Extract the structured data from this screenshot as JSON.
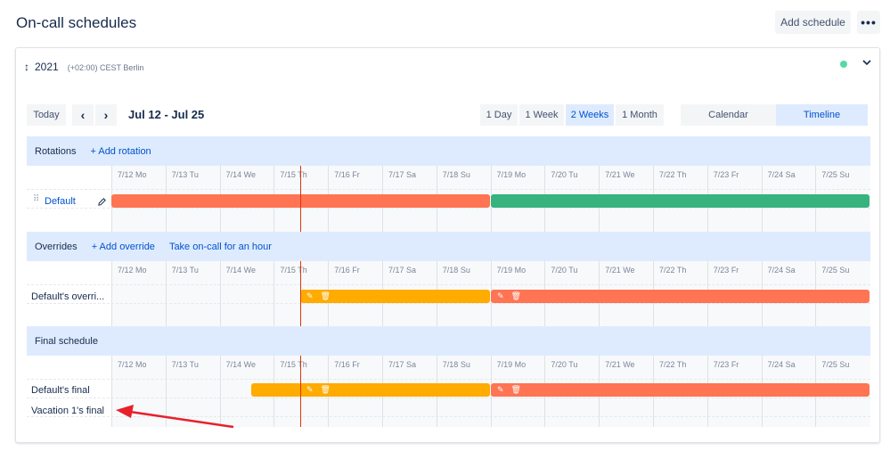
{
  "header": {
    "title": "On-call schedules",
    "add_schedule": "Add schedule",
    "more": "•••"
  },
  "schedule": {
    "year": "2021",
    "sort_icon": "↕",
    "timezone": "(+02:00) CEST Berlin",
    "status_color": "#57d9a3"
  },
  "toolbar": {
    "today": "Today",
    "prev": "‹",
    "next": "›",
    "range": "Jul 12 - Jul 25",
    "views": [
      "1 Day",
      "1 Week",
      "2 Weeks",
      "1 Month"
    ],
    "active_view": "2 Weeks",
    "modes": [
      "Calendar",
      "Timeline"
    ],
    "active_mode": "Timeline"
  },
  "days": [
    "7/12 Mo",
    "7/13 Tu",
    "7/14 We",
    "7/15 Th",
    "7/16 Fr",
    "7/17 Sa",
    "7/18 Su",
    "7/19 Mo",
    "7/20 Tu",
    "7/21 We",
    "7/22 Th",
    "7/23 Fr",
    "7/24 Sa",
    "7/25 Su"
  ],
  "rotations": {
    "title": "Rotations",
    "add_link": "+ Add rotation",
    "rows": [
      {
        "label": "Default"
      }
    ]
  },
  "overrides": {
    "title": "Overrides",
    "add_link": "+ Add override",
    "take_link": "Take on-call for an hour",
    "rows": [
      {
        "label": "Default's overri..."
      }
    ]
  },
  "final": {
    "title": "Final schedule",
    "rows": [
      {
        "label": "Default's final"
      },
      {
        "label": "Vacation 1's final"
      }
    ]
  },
  "colors": {
    "rotation_1": "#ff7452",
    "rotation_2": "#36b37e",
    "override": "#ffab00",
    "now_line": "#de350b",
    "annotation_arrow": "#e8202a"
  }
}
